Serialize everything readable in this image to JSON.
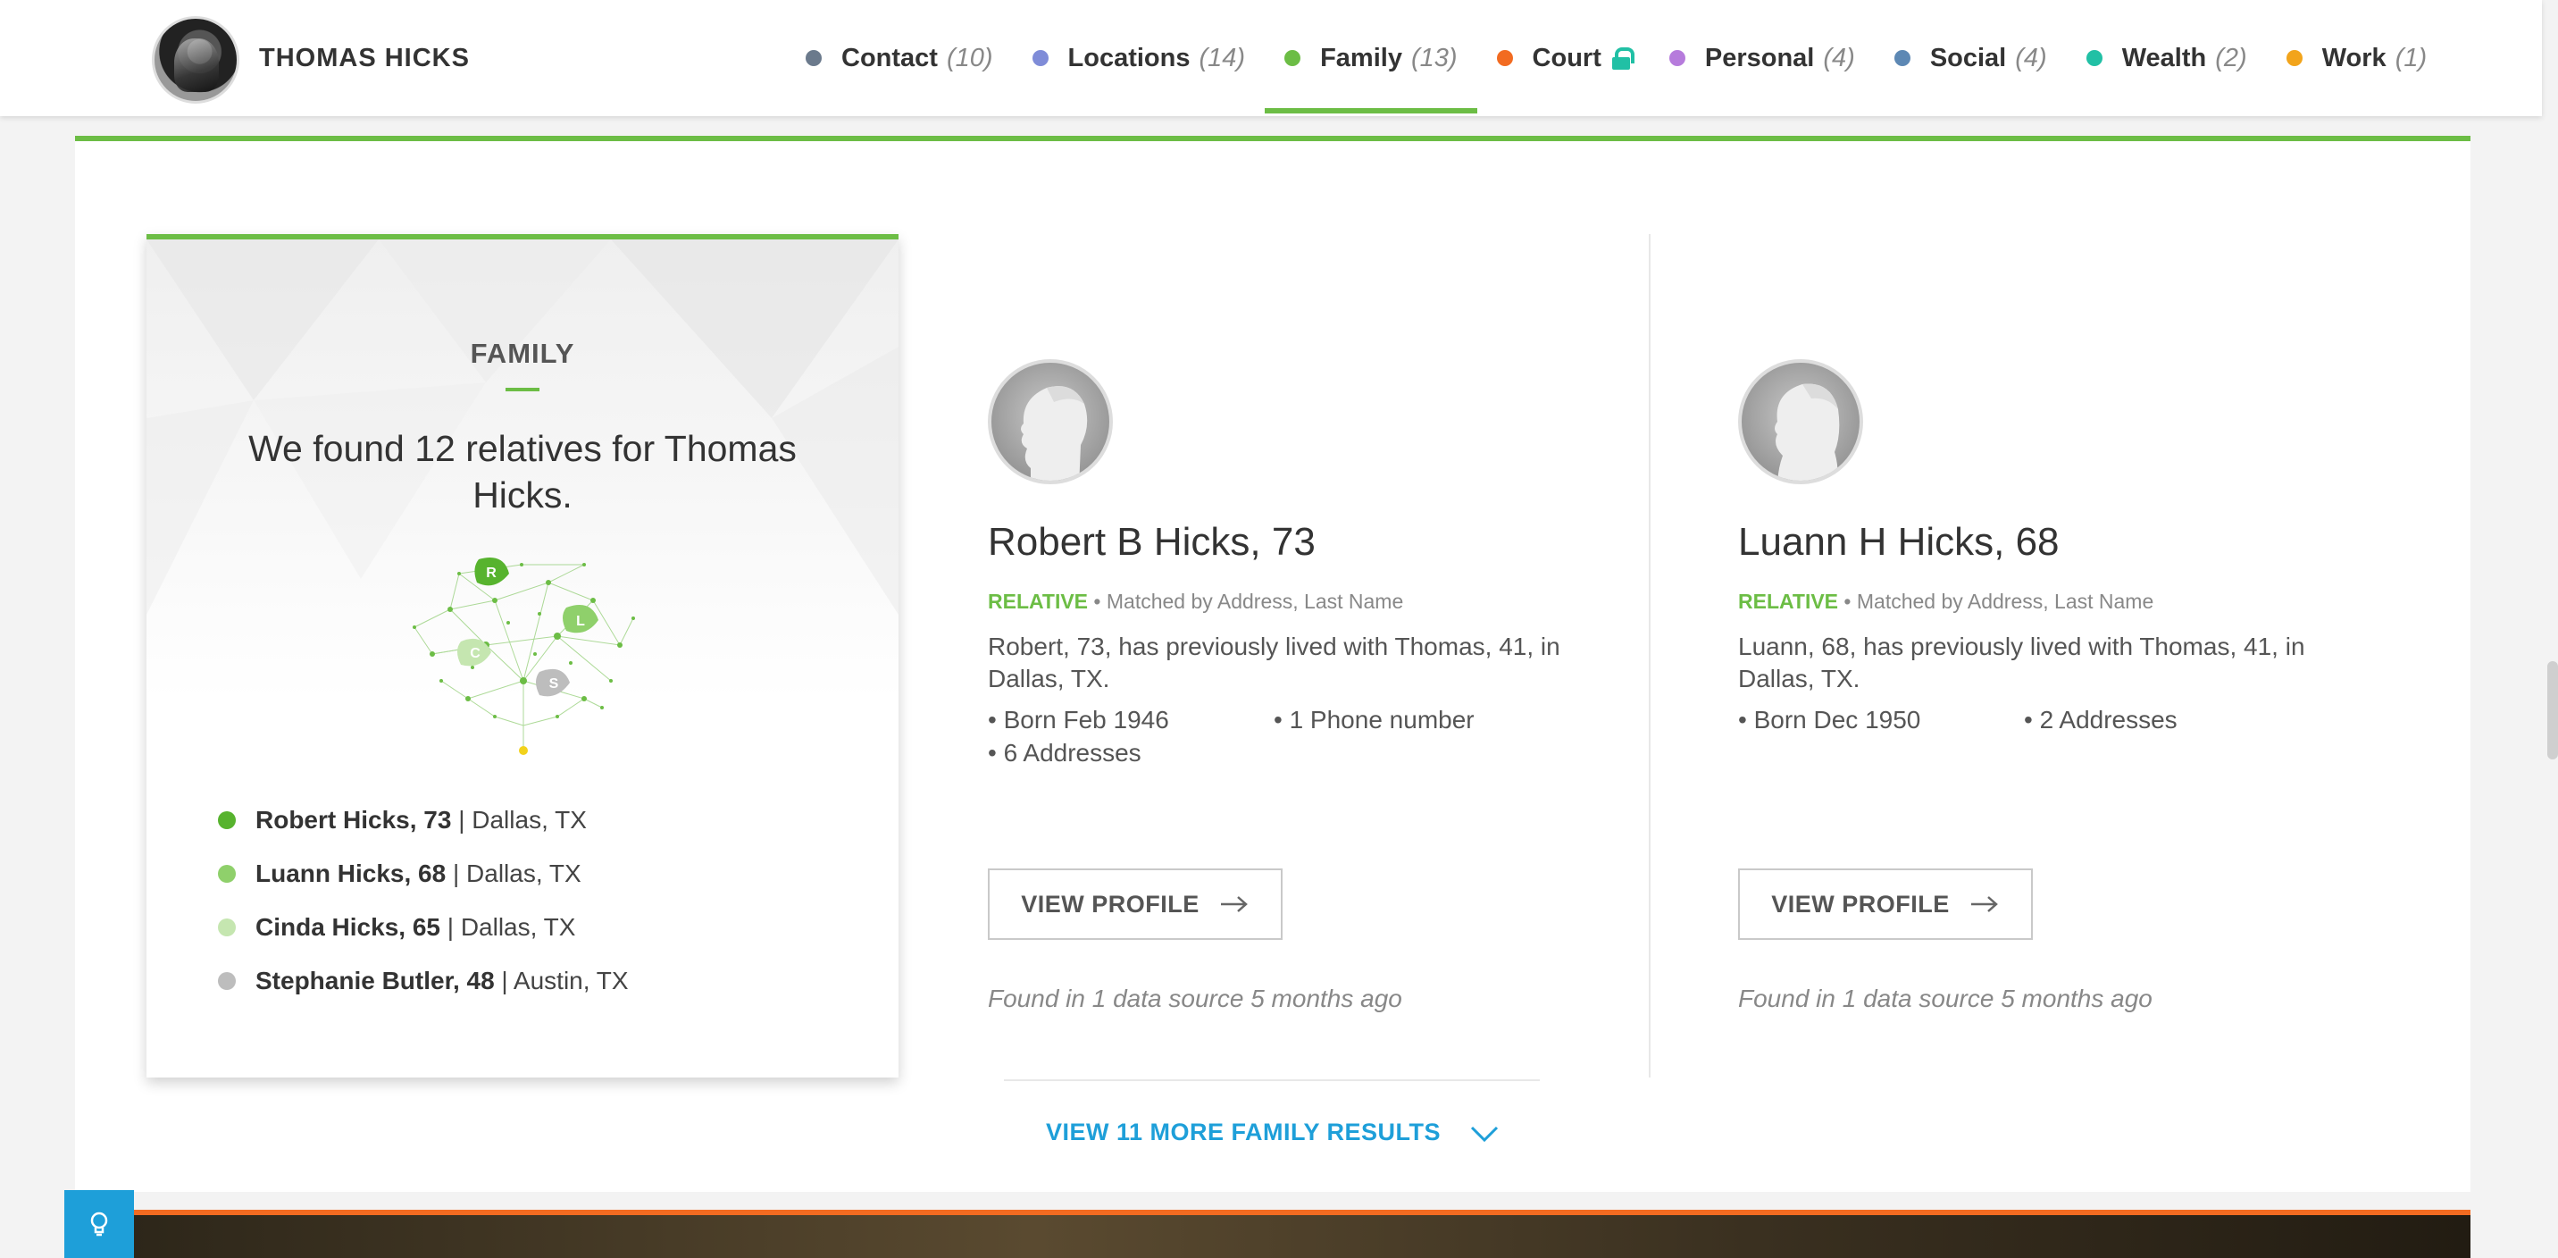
{
  "header": {
    "person_name": "THOMAS HICKS",
    "nav": [
      {
        "label": "Contact",
        "count": "(10)",
        "color": "#6b7a8c"
      },
      {
        "label": "Locations",
        "count": "(14)",
        "color": "#7f8cd8"
      },
      {
        "label": "Family",
        "count": "(13)",
        "color": "#6cbd45",
        "active": true
      },
      {
        "label": "Court",
        "count": "",
        "color": "#f26b21",
        "locked": true
      },
      {
        "label": "Personal",
        "count": "(4)",
        "color": "#b67bdc"
      },
      {
        "label": "Social",
        "count": "(4)",
        "color": "#5d88b4"
      },
      {
        "label": "Wealth",
        "count": "(2)",
        "color": "#21c0a5"
      },
      {
        "label": "Work",
        "count": "(1)",
        "color": "#f2a41b"
      }
    ]
  },
  "summary": {
    "heading": "FAMILY",
    "text": "We found 12 relatives for Thomas Hicks.",
    "tree_leaves": [
      "R",
      "L",
      "C",
      "S"
    ],
    "relatives": [
      {
        "name": "Robert Hicks, 73",
        "location": "| Dallas, TX",
        "color": "#57b32e"
      },
      {
        "name": "Luann Hicks, 68",
        "location": "| Dallas, TX",
        "color": "#8fd06b"
      },
      {
        "name": "Cinda Hicks, 65",
        "location": "| Dallas, TX",
        "color": "#c5e6b0"
      },
      {
        "name": "Stephanie Butler, 48",
        "location": "| Austin, TX",
        "color": "#bdbdbd"
      }
    ]
  },
  "cards": [
    {
      "name": "Robert B Hicks, 73",
      "tag": "RELATIVE",
      "match": "• Matched by Address, Last Name",
      "desc": "Robert, 73, has previously lived with Thomas, 41, in Dallas, TX.",
      "facts": [
        "• Born Feb 1946",
        "• 1 Phone number",
        "• 6 Addresses"
      ],
      "button": "VIEW PROFILE",
      "source": "Found in 1 data source 5 months ago"
    },
    {
      "name": "Luann H Hicks, 68",
      "tag": "RELATIVE",
      "match": "• Matched by Address, Last Name",
      "desc": "Luann, 68, has previously lived with Thomas, 41, in Dallas, TX.",
      "facts": [
        "• Born Dec 1950",
        "• 2 Addresses"
      ],
      "button": "VIEW PROFILE",
      "source": "Found in 1 data source 5 months ago"
    }
  ],
  "more_results": "VIEW 11 MORE FAMILY RESULTS",
  "icons": [
    "lock-icon",
    "arrow-right-icon",
    "chevron-down-icon",
    "lightbulb-icon",
    "family-tree-icon"
  ]
}
